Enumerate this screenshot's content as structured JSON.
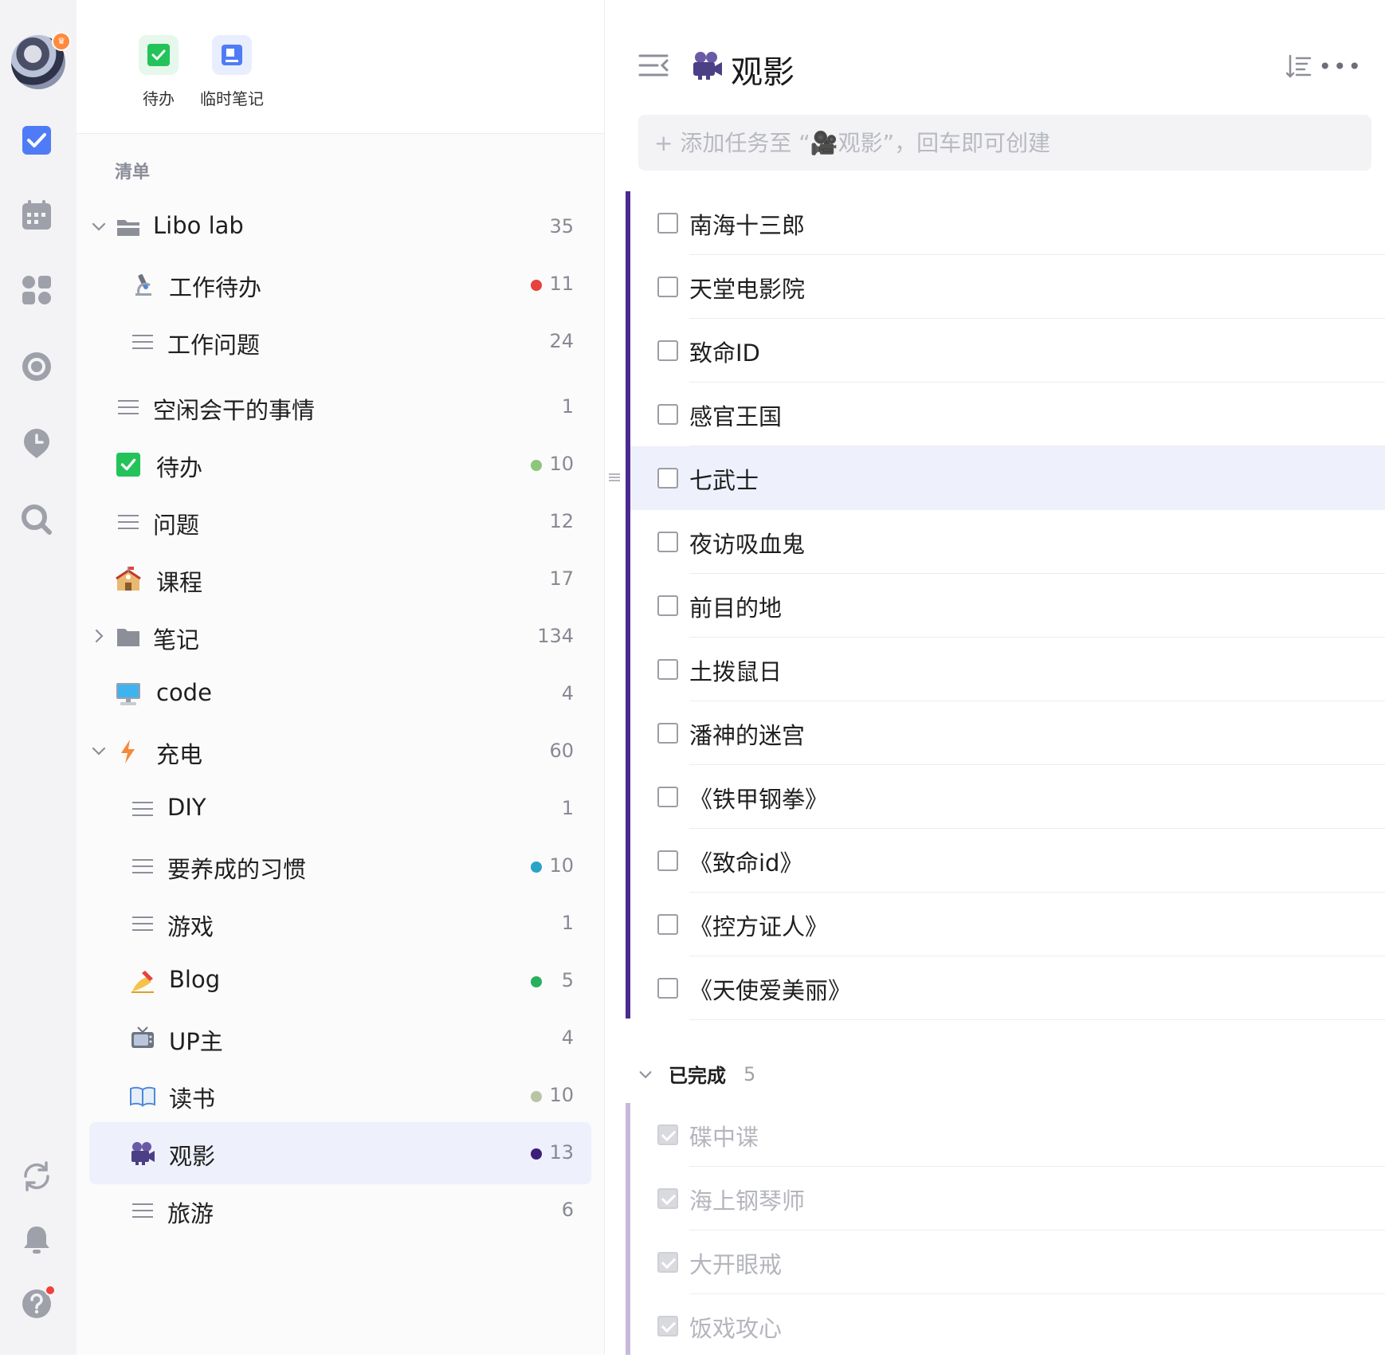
{
  "rail": {
    "icons": [
      "todo-icon",
      "calendar-icon",
      "grid-icon",
      "focus-icon",
      "habit-icon",
      "search-icon",
      "sync-icon",
      "bell-icon",
      "help-icon"
    ]
  },
  "quick_actions": [
    {
      "label": "待办",
      "icon": "checkbox-icon",
      "color": "#23c35a"
    },
    {
      "label": "临时笔记",
      "icon": "note-icon",
      "color": "#4f7cf6"
    }
  ],
  "sidebar": {
    "section_label": "清单",
    "items": [
      {
        "name": "Libo lab",
        "count": "35",
        "icon": "folder-icon",
        "chevron": "down",
        "indent": 0
      },
      {
        "name": "工作待办",
        "count": "11",
        "icon": "microscope-icon",
        "dot": "#e8413d",
        "indent": 1
      },
      {
        "name": "工作问题",
        "count": "24",
        "icon": "list-icon",
        "indent": 1
      },
      {
        "name": "空闲会干的事情",
        "count": "1",
        "icon": "list-icon",
        "indent": 0
      },
      {
        "name": "待办",
        "count": "10",
        "icon": "checkbox-icon",
        "dot": "#8cc67a",
        "indent": 0
      },
      {
        "name": "问题",
        "count": "12",
        "icon": "list-icon",
        "indent": 0
      },
      {
        "name": "课程",
        "count": "17",
        "icon": "school-icon",
        "indent": 0
      },
      {
        "name": "笔记",
        "count": "134",
        "icon": "folder-icon",
        "chevron": "right",
        "indent": 0
      },
      {
        "name": "code",
        "count": "4",
        "icon": "computer-icon",
        "indent": 0
      },
      {
        "name": "充电",
        "count": "60",
        "icon": "lightning-icon",
        "chevron": "down",
        "indent": 0
      },
      {
        "name": "DIY",
        "count": "1",
        "icon": "list-icon",
        "indent": 1
      },
      {
        "name": "要养成的习惯",
        "count": "10",
        "icon": "list-icon",
        "dot": "#2aa3c9",
        "indent": 1
      },
      {
        "name": "游戏",
        "count": "1",
        "icon": "list-icon",
        "indent": 1
      },
      {
        "name": "Blog",
        "count": "5",
        "icon": "writing-hand-icon",
        "dot": "#27b05e",
        "indent": 1
      },
      {
        "name": "UP主",
        "count": "4",
        "icon": "tv-icon",
        "indent": 1
      },
      {
        "name": "读书",
        "count": "10",
        "icon": "book-icon",
        "dot": "#b9c4a6",
        "indent": 1
      },
      {
        "name": "观影",
        "count": "13",
        "icon": "movie-camera-icon",
        "dot": "#3b1f7a",
        "indent": 1,
        "active": true
      },
      {
        "name": "旅游",
        "count": "6",
        "icon": "list-icon",
        "indent": 1
      }
    ]
  },
  "main": {
    "title": "观影",
    "add_placeholder": "+ 添加任务至 “🎥观影”，回车即可创建",
    "tasks": [
      "南海十三郎",
      "天堂电影院",
      "致命ID",
      "感官王国",
      "七武士",
      "夜访吸血鬼",
      "前目的地",
      "土拨鼠日",
      "潘神的迷宫",
      "《铁甲钢拳》",
      "《致命id》",
      "《控方证人》",
      "《天使爱美丽》"
    ],
    "completed_label": "已完成",
    "completed_count": "5",
    "completed": [
      "碟中谍",
      "海上钢琴师",
      "大开眼戒",
      "饭戏攻心"
    ]
  },
  "colors": {
    "accent": "#4f7cf6",
    "list_bar": "#4b2a8f",
    "done_bar": "#c9b9d9",
    "active_bg": "#eef0fc"
  }
}
